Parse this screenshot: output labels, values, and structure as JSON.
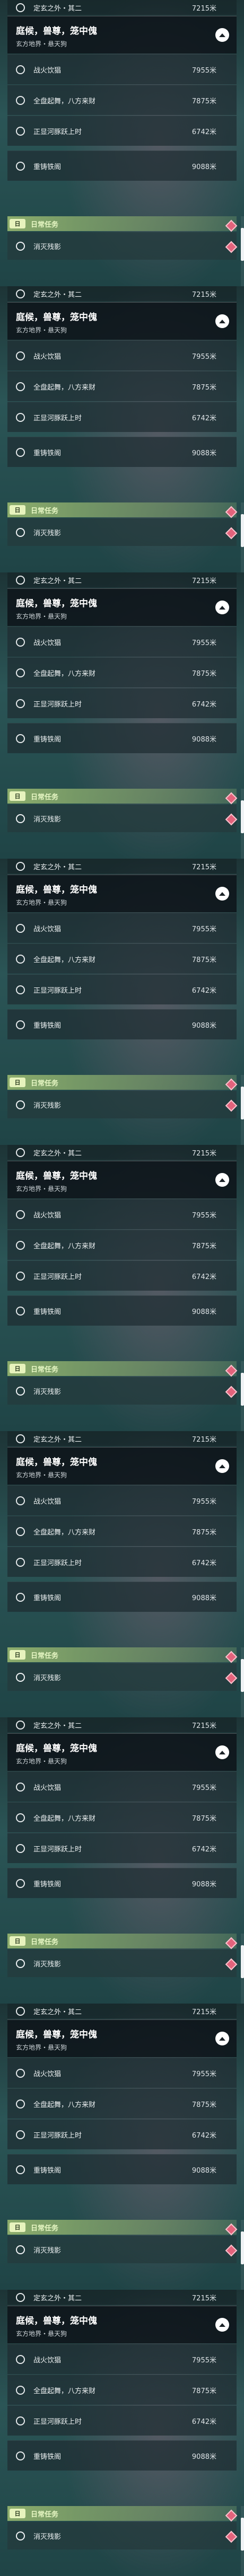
{
  "top_overflow": {
    "label": "定玄之外・其二",
    "distance": "7215米"
  },
  "quest": {
    "title": "庭候，兽尊，笼中傀",
    "subtitle": "玄方地界・悬天狗"
  },
  "objectives": [
    {
      "label": "战火饮猖",
      "distance": "7955米"
    },
    {
      "label": "全盘起舞，八方来财",
      "distance": "7875米"
    },
    {
      "label": "正显河豚跃上时",
      "distance": "6742米"
    },
    {
      "label": "重铸铁阁",
      "distance": "9088米"
    }
  ],
  "daily": {
    "tag": "日",
    "title": "日常任务",
    "task": "消灭残影"
  },
  "pages": [
    1,
    2,
    3,
    4,
    5,
    6,
    7,
    8,
    9
  ],
  "colors": {
    "accent_green": "#92b26e",
    "marker_red": "#e3637c",
    "panel_dark": "#0e141a"
  }
}
